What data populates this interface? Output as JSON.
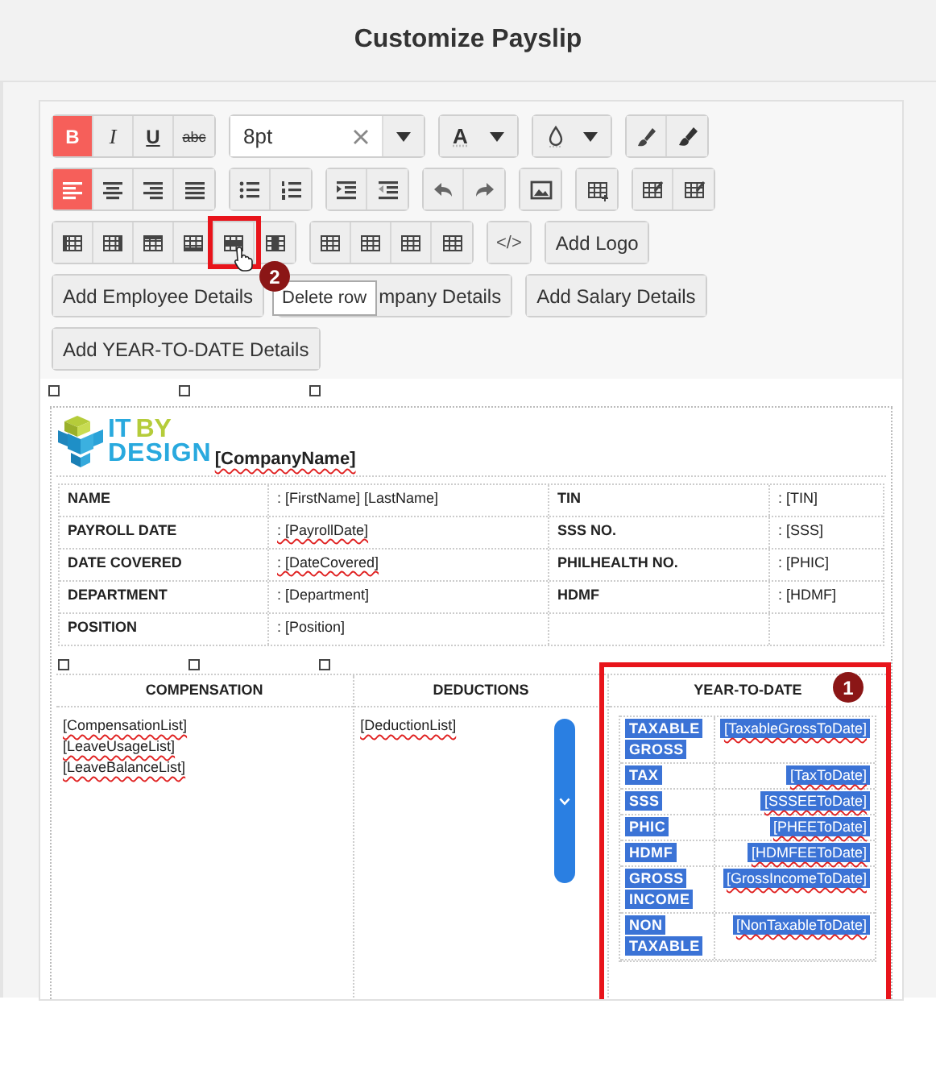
{
  "window": {
    "title": "Customize Payslip"
  },
  "toolbar": {
    "rows": [
      {
        "groups": [
          {
            "items": [
              {
                "kind": "bold",
                "label": "B",
                "active": true
              },
              {
                "kind": "italic",
                "label": "I",
                "active": false
              },
              {
                "kind": "underline",
                "label": "U",
                "active": false
              },
              {
                "kind": "strike",
                "label": "abc",
                "active": false
              }
            ]
          },
          {
            "items": [
              {
                "kind": "font-size",
                "value": "8pt"
              }
            ]
          },
          {
            "items": [
              {
                "kind": "text-color",
                "label": "A"
              }
            ]
          },
          {
            "items": [
              {
                "kind": "fill-color"
              }
            ]
          },
          {
            "items": [
              {
                "kind": "brush",
                "active": false
              },
              {
                "kind": "brush-clear",
                "active": false
              }
            ]
          }
        ]
      },
      {
        "groups": [
          {
            "items": [
              {
                "kind": "align-left",
                "active": true
              },
              {
                "kind": "align-center",
                "active": false
              },
              {
                "kind": "align-right",
                "active": false
              },
              {
                "kind": "justify",
                "active": false
              }
            ]
          },
          {
            "items": [
              {
                "kind": "bullets",
                "active": false
              },
              {
                "kind": "numbers",
                "active": false
              }
            ]
          },
          {
            "items": [
              {
                "kind": "indent",
                "active": false
              },
              {
                "kind": "outdent",
                "active": false
              }
            ]
          },
          {
            "items": [
              {
                "kind": "undo",
                "active": false
              },
              {
                "kind": "redo",
                "active": false
              }
            ]
          },
          {
            "items": [
              {
                "kind": "image",
                "active": false
              }
            ]
          },
          {
            "items": [
              {
                "kind": "table",
                "active": false
              }
            ]
          },
          {
            "items": [
              {
                "kind": "table-edit",
                "active": false
              },
              {
                "kind": "table-edit",
                "active": false
              }
            ]
          }
        ]
      },
      {
        "groups": [
          {
            "items": [
              {
                "kind": "col-left",
                "active": false
              },
              {
                "kind": "col-right",
                "active": false
              },
              {
                "kind": "row-above",
                "active": false
              },
              {
                "kind": "row-below",
                "active": false
              },
              {
                "kind": "row-delete",
                "active": false,
                "hovered": true,
                "tooltip": "Delete row",
                "annotation": "2"
              },
              {
                "kind": "col-delete",
                "active": false
              }
            ]
          },
          {
            "items": [
              {
                "kind": "grid",
                "active": false
              },
              {
                "kind": "grid",
                "active": false
              },
              {
                "kind": "grid",
                "active": false
              },
              {
                "kind": "grid",
                "active": false
              }
            ]
          },
          {
            "items": [
              {
                "kind": "code",
                "label": "</>",
                "active": false
              }
            ]
          },
          {
            "items": [
              {
                "kind": "text-button",
                "label": "Add Logo",
                "covered": false
              }
            ]
          }
        ]
      },
      {
        "groups": [
          {
            "items": [
              {
                "kind": "text-button",
                "label": "Add Employee Details",
                "covered": false
              }
            ]
          },
          {
            "items": [
              {
                "kind": "text-button",
                "label": "mpany Details",
                "covered": true
              }
            ]
          },
          {
            "items": [
              {
                "kind": "text-button",
                "label": "Add Salary Details",
                "covered": false
              }
            ]
          }
        ]
      },
      {
        "groups": [
          {
            "items": [
              {
                "kind": "text-button",
                "label": "Add YEAR-TO-DATE Details",
                "covered": false
              }
            ]
          }
        ]
      }
    ]
  },
  "document": {
    "logo": {
      "first": "IT",
      "second": "BY",
      "third": "DESIGN"
    },
    "company_name": "[CompanyName]",
    "details": [
      {
        "cells": [
          {
            "text": "NAME",
            "flagged": false
          },
          {
            "text": ": [FirstName] [LastName]",
            "flagged": false
          },
          {
            "text": "TIN",
            "flagged": false
          },
          {
            "text": ": [TIN]",
            "flagged": false
          }
        ]
      },
      {
        "cells": [
          {
            "text": "PAYROLL DATE",
            "flagged": false
          },
          {
            "text": ": [PayrollDate]",
            "flagged": true
          },
          {
            "text": "SSS NO.",
            "flagged": false
          },
          {
            "text": ": [SSS]",
            "flagged": false
          }
        ]
      },
      {
        "cells": [
          {
            "text": "DATE COVERED",
            "flagged": false
          },
          {
            "text": ": [DateCovered]",
            "flagged": true
          },
          {
            "text": "PHILHEALTH NO.",
            "flagged": false
          },
          {
            "text": ": [PHIC]",
            "flagged": false
          }
        ]
      },
      {
        "cells": [
          {
            "text": "DEPARTMENT",
            "flagged": false
          },
          {
            "text": ": [Department]",
            "flagged": false
          },
          {
            "text": "HDMF",
            "flagged": false
          },
          {
            "text": ": [HDMF]",
            "flagged": false
          }
        ]
      },
      {
        "cells": [
          {
            "text": "POSITION",
            "flagged": false
          },
          {
            "text": ": [Position]",
            "flagged": false
          }
        ]
      }
    ],
    "sections": [
      {
        "kind": "list",
        "heading": "COMPENSATION",
        "lines": [
          {
            "text": "[CompensationList]",
            "flagged": true
          },
          {
            "text": "[LeaveUsageList]",
            "flagged": true
          },
          {
            "text": "[LeaveBalanceList]",
            "flagged": true
          }
        ]
      },
      {
        "kind": "list",
        "heading": "DEDUCTIONS",
        "lines": [
          {
            "text": "[DeductionList]",
            "flagged": true
          }
        ],
        "scroll_button": true
      },
      {
        "kind": "table",
        "heading": "YEAR-TO-DATE",
        "annotation": "1",
        "rows": [
          {
            "label": "TAXABLE GROSS",
            "value": "[TaxableGrossToDate]",
            "selected": true
          },
          {
            "label": "TAX",
            "value": "[TaxToDate]",
            "selected": true
          },
          {
            "label": "SSS",
            "value": "[SSSEEToDate]",
            "selected": true
          },
          {
            "label": "PHIC",
            "value": "[PHEEToDate]",
            "selected": true
          },
          {
            "label": "HDMF",
            "value": "[HDMFEEToDate]",
            "selected": true
          },
          {
            "label": "GROSS INCOME",
            "value": "[GrossIncomeToDate]",
            "selected": true
          },
          {
            "label": "NON TAXABLE",
            "value": "[NonTaxableToDate]",
            "selected": true
          }
        ]
      }
    ]
  }
}
